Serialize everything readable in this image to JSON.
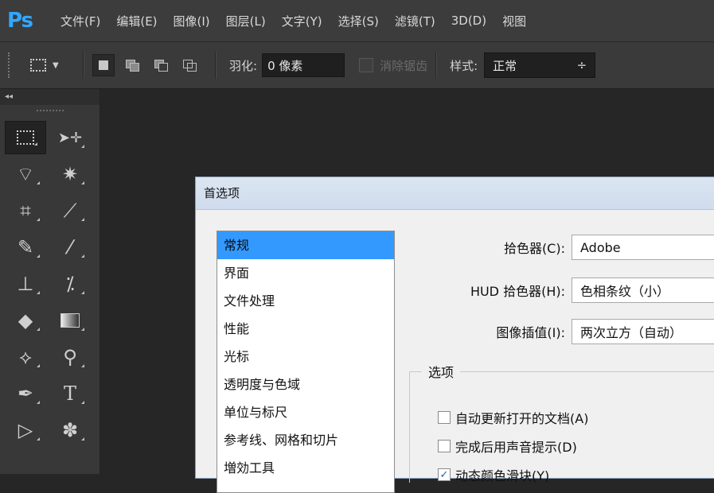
{
  "app": {
    "logo": "Ps"
  },
  "menu": [
    "文件(F)",
    "编辑(E)",
    "图像(I)",
    "图层(L)",
    "文字(Y)",
    "选择(S)",
    "滤镜(T)",
    "3D(D)",
    "视图"
  ],
  "options_bar": {
    "feather_label": "羽化:",
    "feather_value": "0 像素",
    "antialias_label": "消除锯齿",
    "style_label": "样式:",
    "style_value": "正常",
    "style_arrow": "÷"
  },
  "tool_panel": {
    "collapse_glyph": "◂◂"
  },
  "dialog": {
    "title": "首选项",
    "categories": [
      "常规",
      "界面",
      "文件处理",
      "性能",
      "光标",
      "透明度与色域",
      "单位与标尺",
      "参考线、网格和切片",
      "増効工具"
    ],
    "selected_category": 0,
    "fields": {
      "color_picker_label": "拾色器(C):",
      "color_picker_value": "Adobe",
      "hud_picker_label": "HUD 拾色器(H):",
      "hud_picker_value": "色相条纹（小）",
      "interp_label": "图像插值(I):",
      "interp_value": "两次立方（自动）"
    },
    "options_group_title": "选项",
    "checkboxes": [
      {
        "label": "自动更新打开的文档(A)",
        "checked": false
      },
      {
        "label": "完成后用声音提示(D)",
        "checked": false
      },
      {
        "label": "动态颜色滑块(Y)",
        "checked": true
      }
    ]
  },
  "colors": {
    "accent": "#31a8ff",
    "selection": "#3399ff"
  }
}
